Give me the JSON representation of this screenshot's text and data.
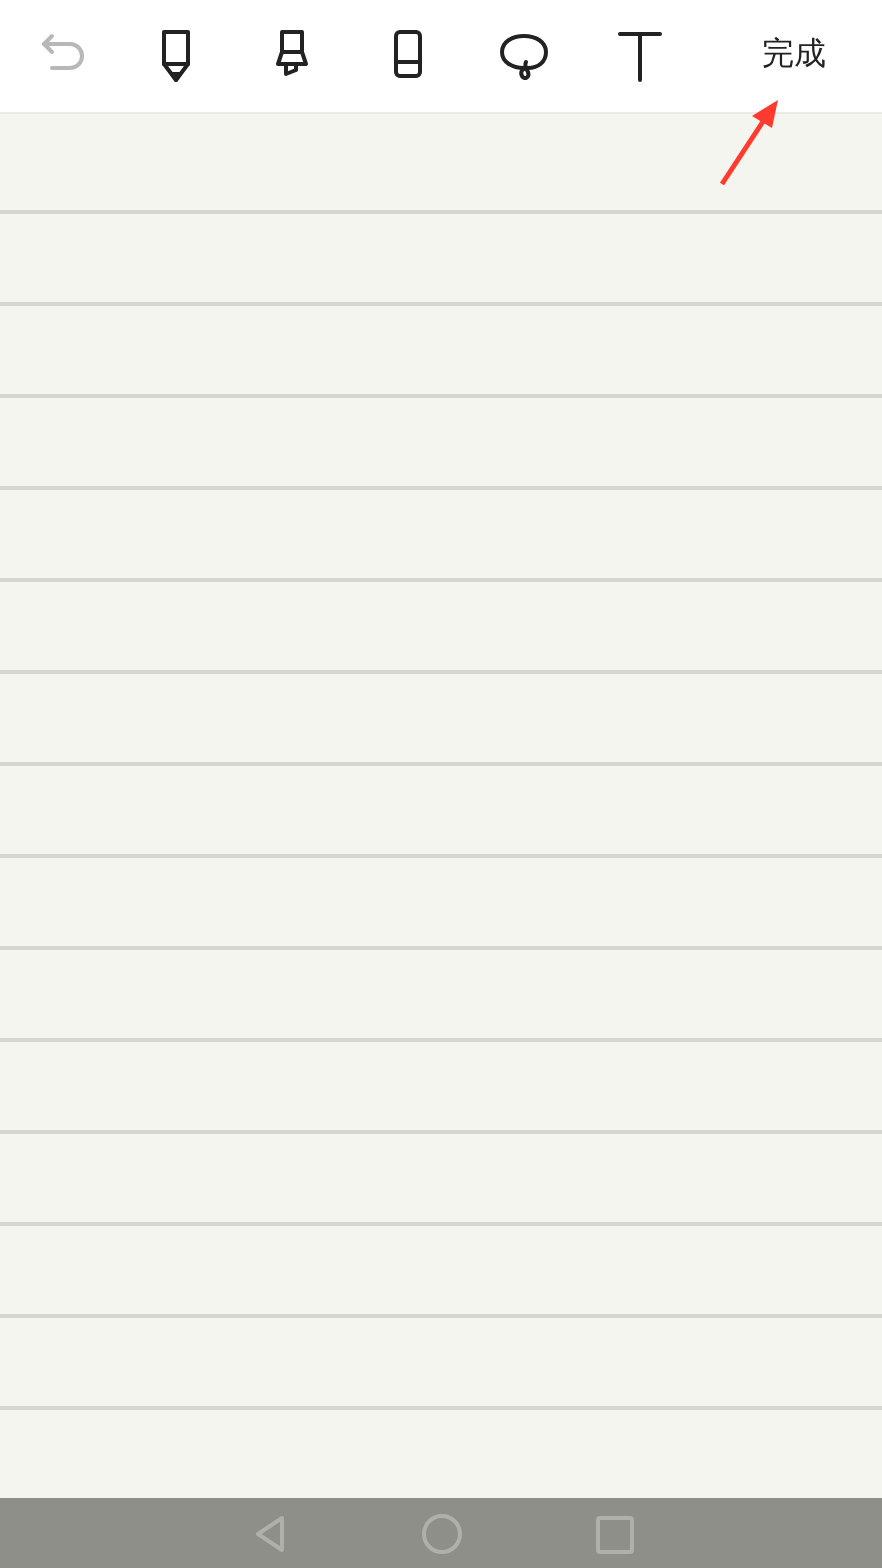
{
  "toolbar": {
    "tools": [
      {
        "kind": "undo",
        "disabled": true
      },
      {
        "kind": "pen",
        "disabled": false
      },
      {
        "kind": "marker",
        "disabled": false
      },
      {
        "kind": "eraser",
        "disabled": false
      },
      {
        "kind": "lasso",
        "disabled": false
      },
      {
        "kind": "text",
        "disabled": false
      }
    ],
    "done_button": "完成"
  },
  "annotation": {
    "kind": "arrow",
    "color": "#ff3b30"
  },
  "nav_bar": {
    "buttons": [
      {
        "kind": "back"
      },
      {
        "kind": "home"
      },
      {
        "kind": "recents"
      }
    ]
  }
}
